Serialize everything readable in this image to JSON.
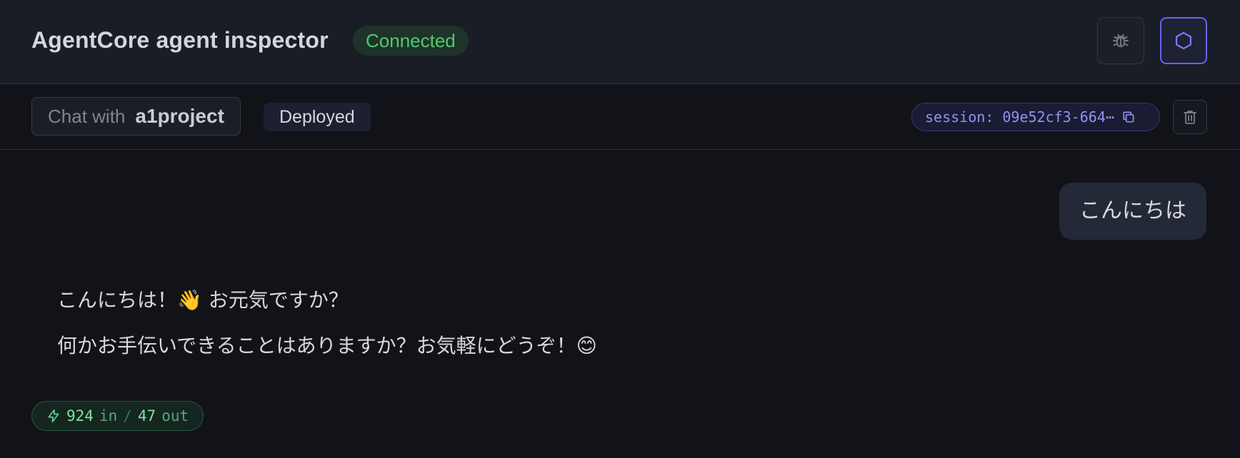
{
  "header": {
    "title": "AgentCore agent inspector",
    "status": "Connected",
    "debug_icon": "bug-icon",
    "agent_icon": "hexagon-icon"
  },
  "toolbar": {
    "chat_with_label": "Chat with",
    "agent_name": "a1project",
    "deploy_badge": "Deployed",
    "session_label": "session: 09e52cf3-664⋯",
    "copy_icon": "copy-icon",
    "clear_icon": "trash-icon"
  },
  "messages": {
    "user": "こんにちは",
    "assistant": [
      "こんにちは！👋 お元気ですか？",
      "何かお手伝いできることはありますか？お気軽にどうぞ！😊"
    ]
  },
  "usage": {
    "icon": "lightning-icon",
    "in_value": "924",
    "in_label": "in",
    "separator": "/",
    "out_value": "47",
    "out_label": "out"
  },
  "colors": {
    "background": "#121318",
    "header_bg": "#1a1d26",
    "status_green": "#54c772",
    "accent_indigo": "#6366f1",
    "token_green": "#7ee3a1"
  }
}
